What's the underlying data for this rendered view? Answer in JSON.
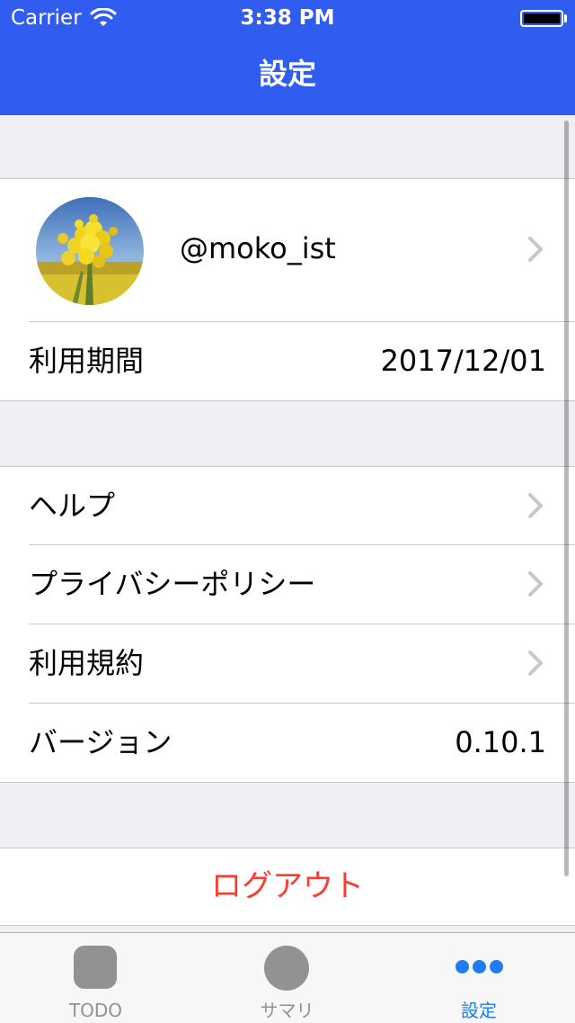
{
  "status_bar": {
    "carrier": "Carrier",
    "time": "3:38 PM"
  },
  "nav": {
    "title": "設定"
  },
  "profile": {
    "username": "@moko_ist",
    "avatar_icon": "avatar-photo-rapeseed-flowers"
  },
  "usage": {
    "label": "利用期間",
    "value": "2017/12/01"
  },
  "menu": {
    "help": "ヘルプ",
    "privacy": "プライバシーポリシー",
    "terms": "利用規約",
    "version_label": "バージョン",
    "version_value": "0.10.1"
  },
  "logout": {
    "label": "ログアウト"
  },
  "tabbar": {
    "tabs": [
      {
        "label": "TODO",
        "icon": "square-icon",
        "active": false
      },
      {
        "label": "サマリ",
        "icon": "circle-icon",
        "active": false
      },
      {
        "label": "設定",
        "icon": "more-dots-icon",
        "active": true
      }
    ]
  },
  "colors": {
    "nav_bar": "#305cf0",
    "background": "#efeff4",
    "logout_text": "#ff3b30",
    "tab_active": "#1f7cf5",
    "tab_inactive": "#929292"
  }
}
